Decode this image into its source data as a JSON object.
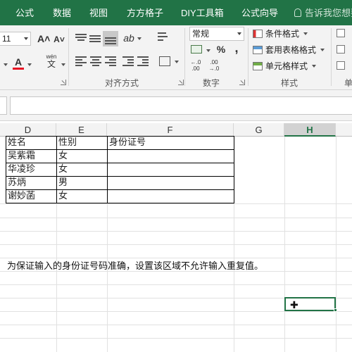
{
  "ribbon_tabs": [
    "公式",
    "数据",
    "视图",
    "方方格子",
    "DIY工具箱",
    "公式向导"
  ],
  "tell_me": "告诉我您想要",
  "font": {
    "size": "11",
    "grow_label": "A˄",
    "shrink_label": "A˅",
    "font_color_label": "A",
    "phonetic_label": "wén"
  },
  "groups": {
    "alignment": "对齐方式",
    "number": "数字",
    "styles": "样式",
    "cells_partial": "单"
  },
  "number": {
    "format_value": "常规",
    "percent_label": "%",
    "comma_label": ",",
    "increase_decimal_label": "←.0 .00",
    "decrease_decimal_label": ".00 →.0"
  },
  "styles": {
    "conditional_formatting": "条件格式",
    "format_as_table": "套用表格格式",
    "cell_styles": "单元格样式"
  },
  "columns": [
    "D",
    "E",
    "F",
    "G",
    "H"
  ],
  "selected_column": "H",
  "table": {
    "headers": [
      "姓名",
      "性别",
      "身份证号"
    ],
    "rows": [
      [
        "吴紫霜",
        "女",
        ""
      ],
      [
        "华凌珍",
        "女",
        ""
      ],
      [
        "苏炳",
        "男",
        ""
      ],
      [
        "谢妙菡",
        "女",
        ""
      ]
    ]
  },
  "note": "为保证输入的身份证号码准确，设置该区域不允许输入重复值。",
  "colors": {
    "accent": "#217346",
    "ribbon_bg": "#f3f3f3",
    "font_color_bar": "#e81123"
  }
}
